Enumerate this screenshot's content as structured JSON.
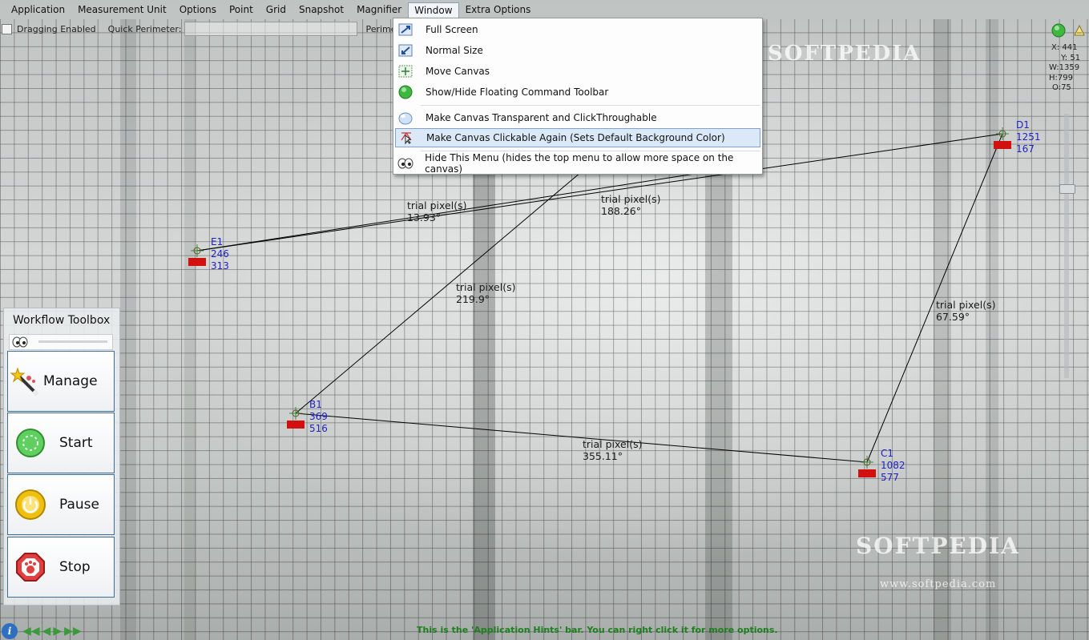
{
  "menubar": {
    "items": [
      "Application",
      "Measurement Unit",
      "Options",
      "Point",
      "Grid",
      "Snapshot",
      "Magnifier",
      "Window",
      "Extra Options"
    ],
    "open_item": "Window"
  },
  "toolbar2": {
    "dragging_label": "Dragging Enabled",
    "quick_perimeter_label": "Quick Perimeter:",
    "perimeter_label": "Perimeter Va"
  },
  "window_menu": {
    "items": [
      {
        "label": "Full Screen",
        "icon": "full-screen-icon"
      },
      {
        "label": "Normal Size",
        "icon": "normal-size-icon"
      },
      {
        "label": "Move Canvas",
        "icon": "move-canvas-icon"
      },
      {
        "label": "Show/Hide Floating Command Toolbar",
        "icon": "green-dot-icon"
      },
      {
        "label": "Make Canvas Transparent and ClickThroughable",
        "icon": "transparent-bubble-icon"
      },
      {
        "label": "Make Canvas Clickable Again (Sets Default Background Color)",
        "icon": "cursor-star-icon",
        "highlighted": true
      },
      {
        "label": "Hide This Menu (hides the top menu to allow more space on the canvas)",
        "icon": "eyes-icon"
      }
    ]
  },
  "points": [
    {
      "name": "E1",
      "x": "246",
      "y": "313"
    },
    {
      "name": "D1",
      "x": "1251",
      "y": "167"
    },
    {
      "name": "B1",
      "x": "369",
      "y": "516"
    },
    {
      "name": "C1",
      "x": "1082",
      "y": "577"
    }
  ],
  "measurements": [
    {
      "line1": "trial pixel(s)",
      "line2": "13.93°"
    },
    {
      "line1": "trial pixel(s)",
      "line2": "188.26°"
    },
    {
      "line1": "trial pixel(s)",
      "line2": "219.9°"
    },
    {
      "line1": "trial pixel(s)",
      "line2": "67.59°"
    },
    {
      "line1": "trial pixel(s)",
      "line2": "355.11°"
    }
  ],
  "toolbox": {
    "title": "Workflow Toolbox",
    "buttons": [
      {
        "label": "Manage",
        "icon": "magic-wand-icon"
      },
      {
        "label": "Start",
        "icon": "start-icon"
      },
      {
        "label": "Pause",
        "icon": "pause-icon"
      },
      {
        "label": "Stop",
        "icon": "stop-icon"
      }
    ]
  },
  "right_panel": {
    "x": "X: 441",
    "y": "Y: 51",
    "w": "W:1359",
    "h": "H:799",
    "o": "O:75"
  },
  "watermarks": {
    "top": "SOFTPEDIA",
    "bottom": "SOFTPEDIA",
    "url": "www.softpedia.com"
  },
  "hint_bar": "This is the 'Application Hints' bar. You can right click it for more options.",
  "colors": {
    "marker_red": "#d21010",
    "point_label_blue": "#2020c8",
    "hint_green": "#1d7f1d",
    "menu_highlight": "#dbe8f7"
  }
}
